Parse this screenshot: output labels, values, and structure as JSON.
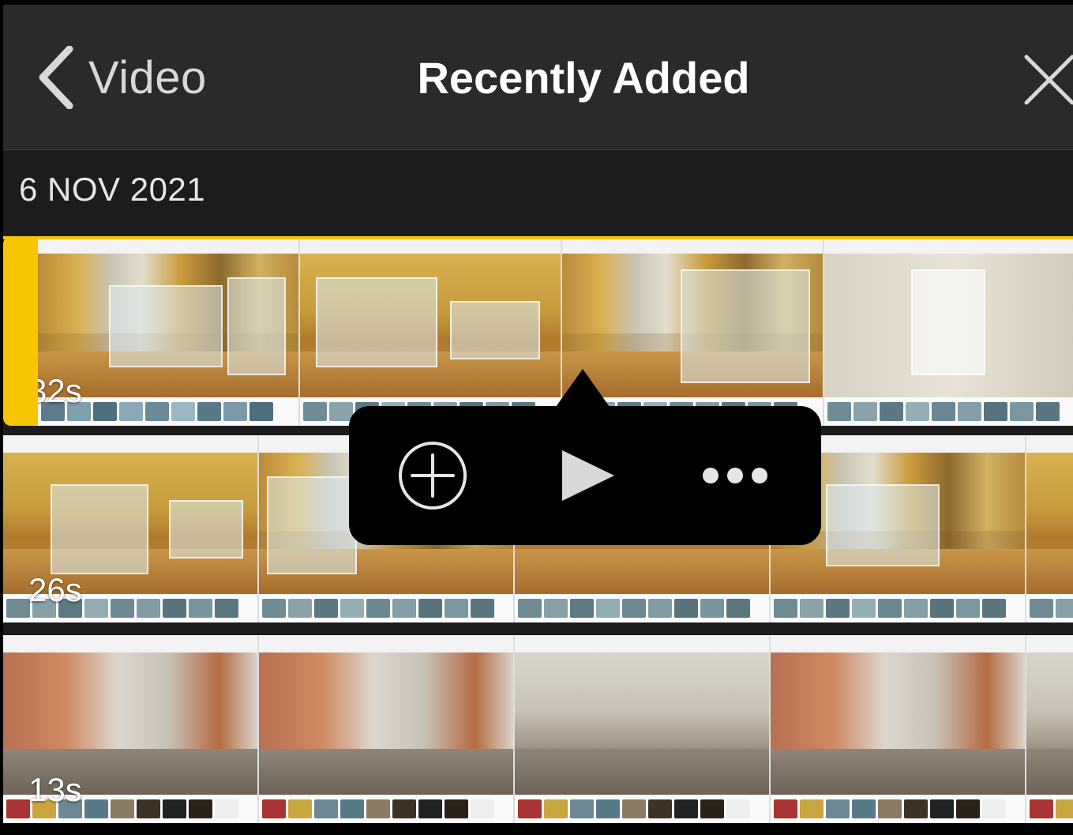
{
  "nav": {
    "back_label": "Video",
    "title": "Recently Added"
  },
  "section": {
    "date": "6 NOV 2021"
  },
  "videos": [
    {
      "duration": "32s",
      "selected": true
    },
    {
      "duration": "26s",
      "selected": false
    },
    {
      "duration": "13s",
      "selected": false
    }
  ],
  "popover": {
    "actions": [
      "add-icon",
      "play-icon",
      "more-icon"
    ]
  },
  "colors": {
    "accent": "#f7c600",
    "navbar": "#2a2a2c",
    "background": "#1c1c1e"
  }
}
